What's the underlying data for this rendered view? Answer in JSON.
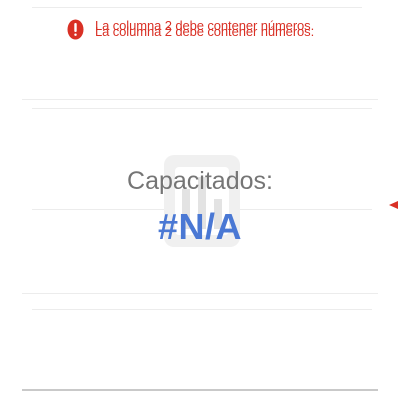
{
  "error": {
    "icon": "alert-icon",
    "message": "La columna 2 debe contener números.",
    "color": "#d93025"
  },
  "scorecard": {
    "title": "Capacitados:",
    "value": "#N/A",
    "title_color": "#757575",
    "value_color": "#4a78d4",
    "watermark_icon": "chart-placeholder-icon"
  }
}
